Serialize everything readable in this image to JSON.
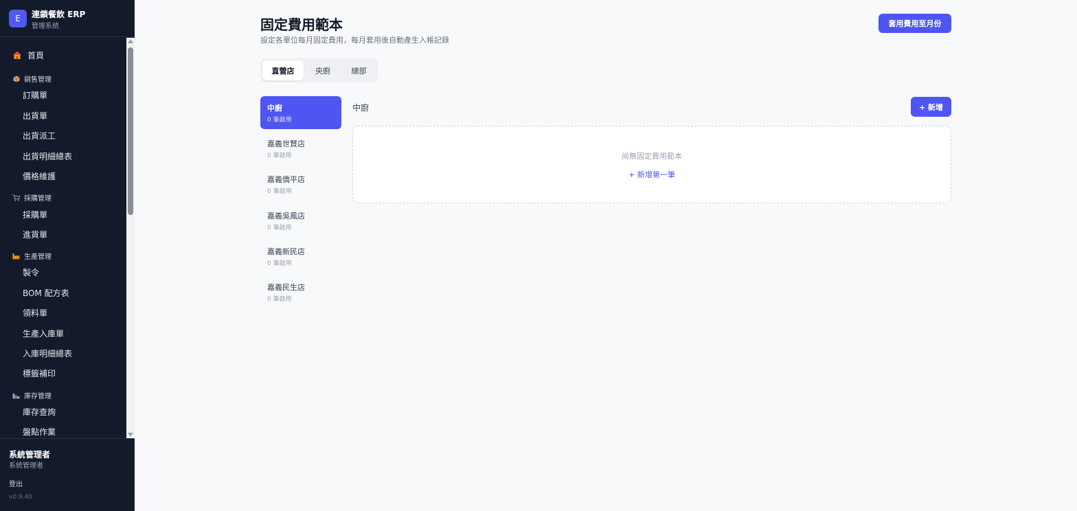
{
  "app": {
    "logo_letter": "E",
    "title": "連鎖餐飲 ERP",
    "subtitle": "管理系統"
  },
  "sidebar": {
    "home": {
      "icon": "house-icon",
      "label": "首頁"
    },
    "sections": [
      {
        "icon": "box-icon",
        "label": "銷售管理",
        "items": [
          "訂購單",
          "出貨單",
          "出貨派工",
          "出貨明細總表",
          "價格維護"
        ]
      },
      {
        "icon": "cart-icon",
        "label": "採購管理",
        "items": [
          "採購單",
          "進貨單"
        ]
      },
      {
        "icon": "factory-icon",
        "label": "生產管理",
        "items": [
          "製令",
          "BOM 配方表",
          "領料單",
          "生產入庫單",
          "入庫明細總表",
          "標籤補印"
        ]
      },
      {
        "icon": "warehouse-icon",
        "label": "庫存管理",
        "items": [
          "庫存查詢",
          "盤點作業"
        ]
      }
    ]
  },
  "user": {
    "name": "系統管理者",
    "role": "系統管理者",
    "logout_label": "登出",
    "version": "v0.9.40"
  },
  "page": {
    "title": "固定費用範本",
    "subtitle": "設定各單位每月固定費用，每月套用後自動產生入帳記錄",
    "apply_button": "套用費用至月份",
    "tabs": [
      {
        "label": "直營店",
        "active": true
      },
      {
        "label": "央廚",
        "active": false
      },
      {
        "label": "總部",
        "active": false
      }
    ],
    "units": [
      {
        "name": "中廚",
        "count": "0 筆啟用",
        "active": true
      },
      {
        "name": "嘉義世賢店",
        "count": "0 筆啟用",
        "active": false
      },
      {
        "name": "嘉義僑平店",
        "count": "0 筆啟用",
        "active": false
      },
      {
        "name": "嘉義吳鳳店",
        "count": "0 筆啟用",
        "active": false
      },
      {
        "name": "嘉義新民店",
        "count": "0 筆啟用",
        "active": false
      },
      {
        "name": "嘉義民生店",
        "count": "0 筆啟用",
        "active": false
      }
    ],
    "panel_title": "中廚",
    "add_button": "+ 新增",
    "empty_text": "尚無固定費用範本",
    "empty_link": "+ 新增第一筆"
  },
  "colors": {
    "sidebar_bg": "#131a2b",
    "accent": "#4f55f1",
    "page_bg": "#f8f9fb"
  }
}
